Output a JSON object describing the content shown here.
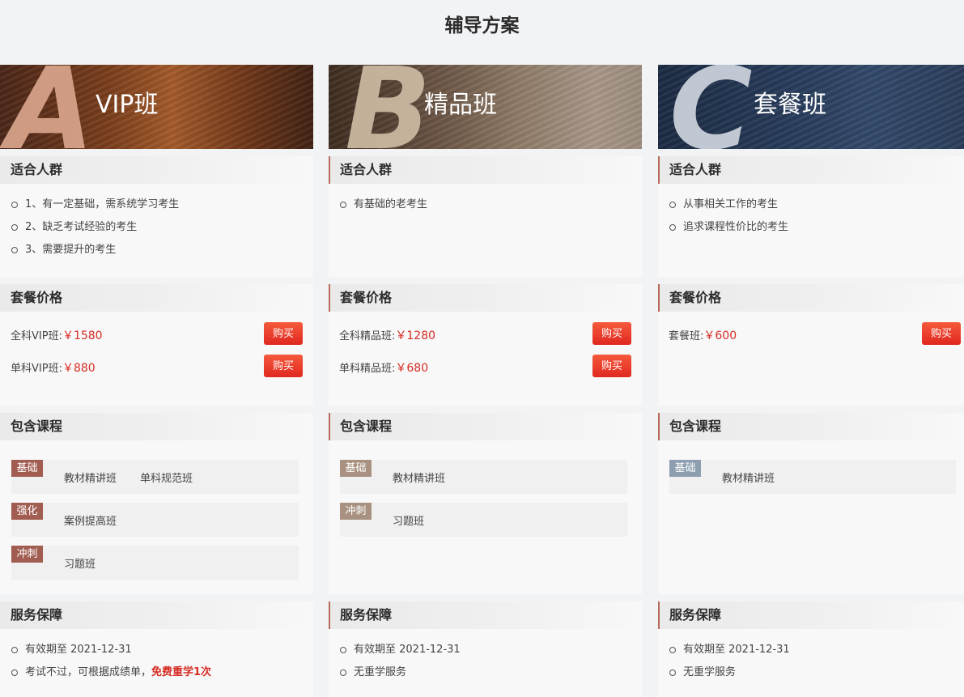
{
  "page_title": "辅导方案",
  "section_titles": {
    "crowd": "适合人群",
    "price": "套餐价格",
    "courses": "包含课程",
    "service": "服务保障"
  },
  "plans": [
    {
      "letter": "A",
      "name": "VIP班",
      "crowd": [
        "1、有一定基础，需系统学习考生",
        "2、缺乏考试经验的考生",
        "3、需要提升的考生"
      ],
      "prices": [
        {
          "label": "全科VIP班:",
          "amount": "￥1580",
          "button": "购买"
        },
        {
          "label": "单科VIP班:",
          "amount": "￥880",
          "button": "购买"
        }
      ],
      "courses": [
        {
          "tag": "基础",
          "items": [
            "教材精讲班",
            "单科规范班"
          ]
        },
        {
          "tag": "强化",
          "items": [
            "案例提高班"
          ]
        },
        {
          "tag": "冲刺",
          "items": [
            "习题班"
          ]
        }
      ],
      "service": [
        "有效期至 2021-12-31"
      ],
      "service_extra": {
        "prefix": "考试不过，可根据成绩单，",
        "highlight": "免费重学1次"
      }
    },
    {
      "letter": "B",
      "name": "精品班",
      "crowd": [
        "有基础的老考生"
      ],
      "prices": [
        {
          "label": "全科精品班:",
          "amount": "￥1280",
          "button": "购买"
        },
        {
          "label": "单科精品班:",
          "amount": "￥680",
          "button": "购买"
        }
      ],
      "courses": [
        {
          "tag": "基础",
          "items": [
            "教材精讲班"
          ]
        },
        {
          "tag": "冲刺",
          "items": [
            "习题班"
          ]
        }
      ],
      "service": [
        "有效期至 2021-12-31",
        "无重学服务"
      ]
    },
    {
      "letter": "C",
      "name": "套餐班",
      "crowd": [
        "从事相关工作的考生",
        "追求课程性价比的考生"
      ],
      "prices": [
        {
          "label": "套餐班:",
          "amount": "￥600",
          "button": "购买"
        }
      ],
      "courses": [
        {
          "tag": "基础",
          "items": [
            "教材精讲班"
          ]
        }
      ],
      "service": [
        "有效期至 2021-12-31",
        "无重学服务"
      ]
    }
  ]
}
